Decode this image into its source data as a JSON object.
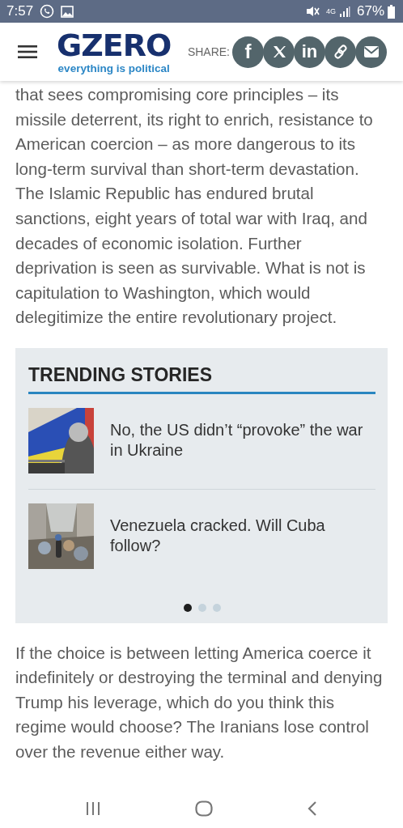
{
  "status_bar": {
    "time": "7:57",
    "network": "4G",
    "battery": "67%"
  },
  "header": {
    "logo": "GZERO",
    "tagline": "everything is political",
    "share_label": "SHARE:",
    "share_buttons": [
      {
        "kind": "facebook",
        "label": "f"
      },
      {
        "kind": "x"
      },
      {
        "kind": "linkedin",
        "label": "in"
      },
      {
        "kind": "link"
      },
      {
        "kind": "email"
      }
    ]
  },
  "content": [
    {
      "kind": "paragraph",
      "text": "that sees compromising core principles – its missile deterrent, its right to enrich, resistance to American coercion – as more dangerous to its long-term survival than short-term devastation. The Islamic Republic has endured brutal sanctions, eight years of total war with Iraq, and decades of economic isolation. Further deprivation is seen as survivable. What is not is capitulation to Washington, which would delegitimize the entire revolutionary project."
    },
    {
      "kind": "trending",
      "title": "TRENDING STORIES",
      "stories": [
        {
          "title": "No, the US didn’t “provoke” the war in Ukraine"
        },
        {
          "title": "Venezuela cracked. Will Cuba follow?"
        }
      ],
      "dots": [
        {
          "selected": true
        },
        {
          "selected": false
        },
        {
          "selected": false
        }
      ]
    },
    {
      "kind": "paragraph",
      "text": "If the choice is between letting America coerce it indefinitely or destroying the terminal and denying Trump his leverage, which do you think this regime would choose? The Iranians lose control over the revenue either way."
    }
  ]
}
